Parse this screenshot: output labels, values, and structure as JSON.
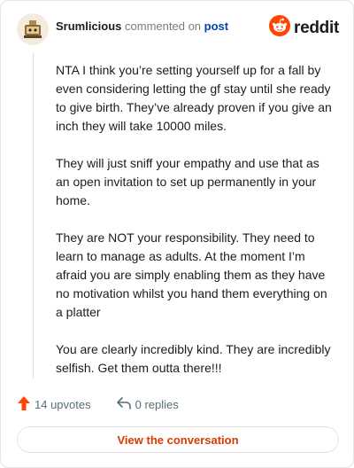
{
  "comment": {
    "username": "Srumlicious",
    "verb": "commented on",
    "post_link": "post",
    "paragraphs": [
      "NTA I think you’re setting yourself up for a fall by even considering letting the gf stay until she ready to give birth. They’ve already proven if you give an inch they will take 10000 miles.",
      "They will just sniff your empathy and use that as an open invitation to set up permanently in your home.",
      "They are NOT your responsibility. They need to learn to manage as adults. At the moment I’m afraid you are simply enabling them as they have no motivation whilst you hand them everything on a platter",
      "You are clearly incredibly kind. They are incredibly selfish. Get them outta there!!!"
    ]
  },
  "brand": {
    "wordmark": "reddit",
    "icon": "reddit-snoo-icon",
    "color": "#ff4500"
  },
  "actions": {
    "upvotes": "14 upvotes",
    "upvote_icon": "upvote-arrow-icon",
    "replies": "0 replies",
    "reply_icon": "reply-arrow-icon"
  },
  "cta": {
    "label": "View the conversation"
  },
  "colors": {
    "accent": "#d93a00",
    "upvote": "#ff4500",
    "link": "#0045ac"
  }
}
